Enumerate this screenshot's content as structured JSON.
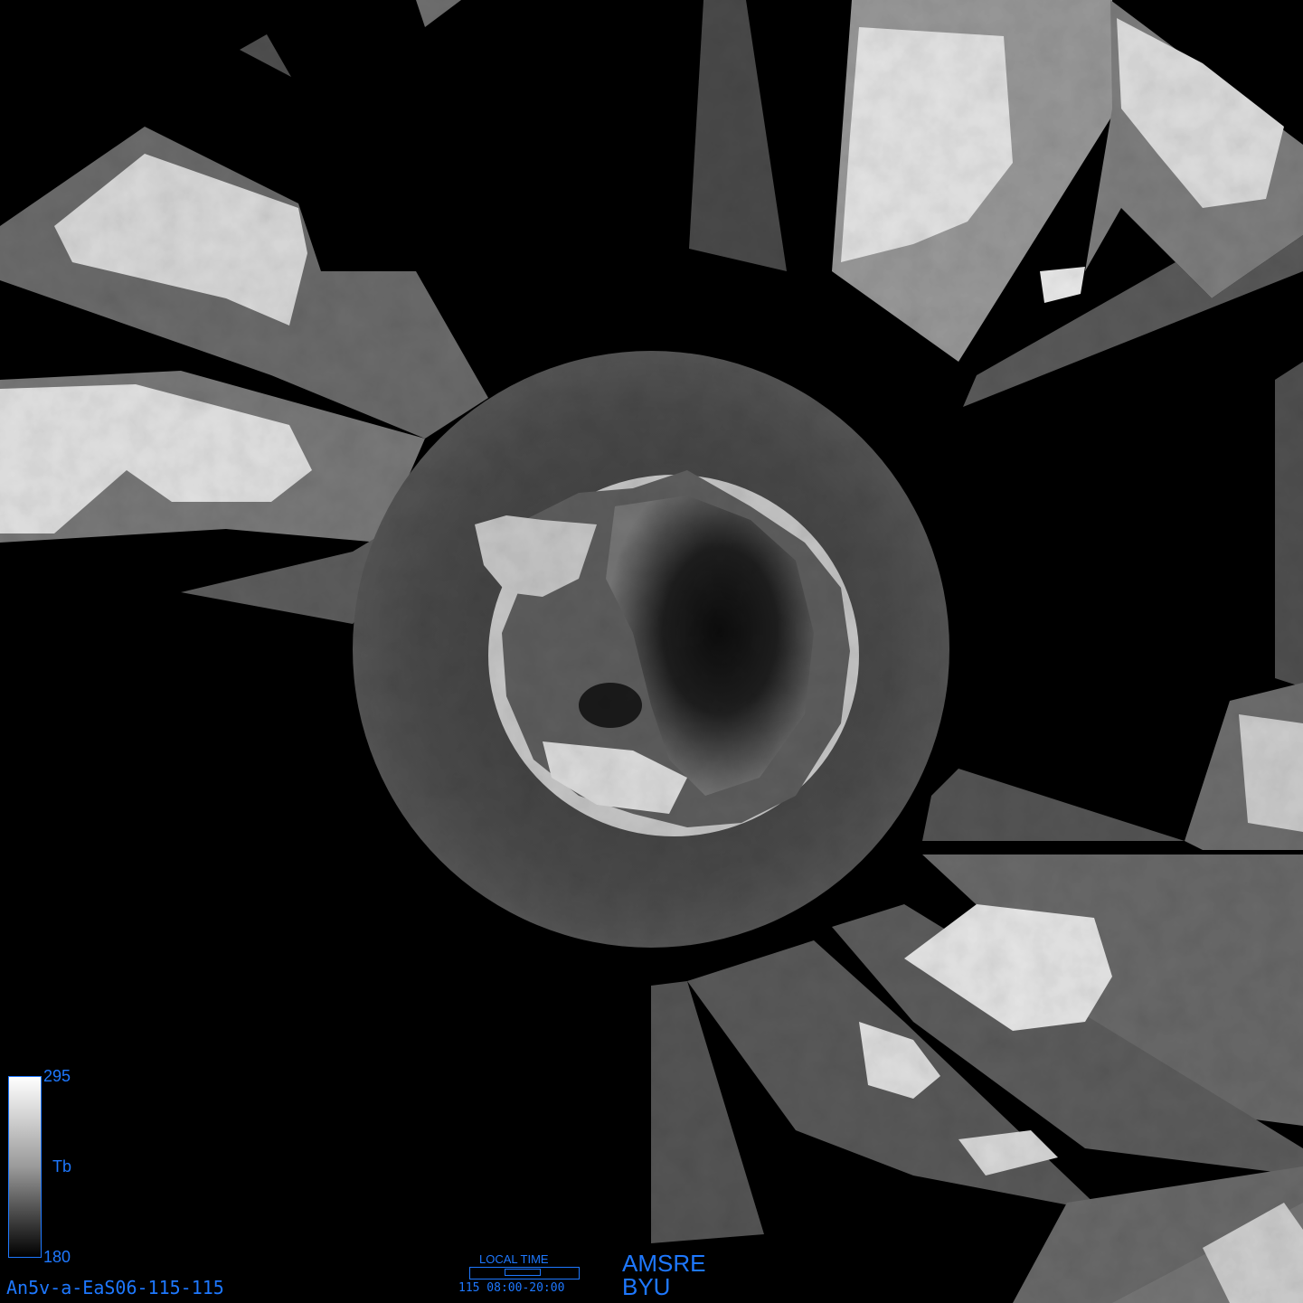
{
  "map": {
    "description_icon": "antarctic-polar-stereographic-brightness-temperature",
    "colors": {
      "background": "#000000",
      "label_blue": "#1e78ff"
    }
  },
  "colorbar": {
    "max_label": "295",
    "mid_label": "Tb",
    "min_label": "180"
  },
  "filename": "An5v-a-EaS06-115-115",
  "local_time": {
    "title": "LOCAL TIME",
    "range": "115 08:00-20:00"
  },
  "sensor": "AMSRE",
  "organization": "BYU"
}
